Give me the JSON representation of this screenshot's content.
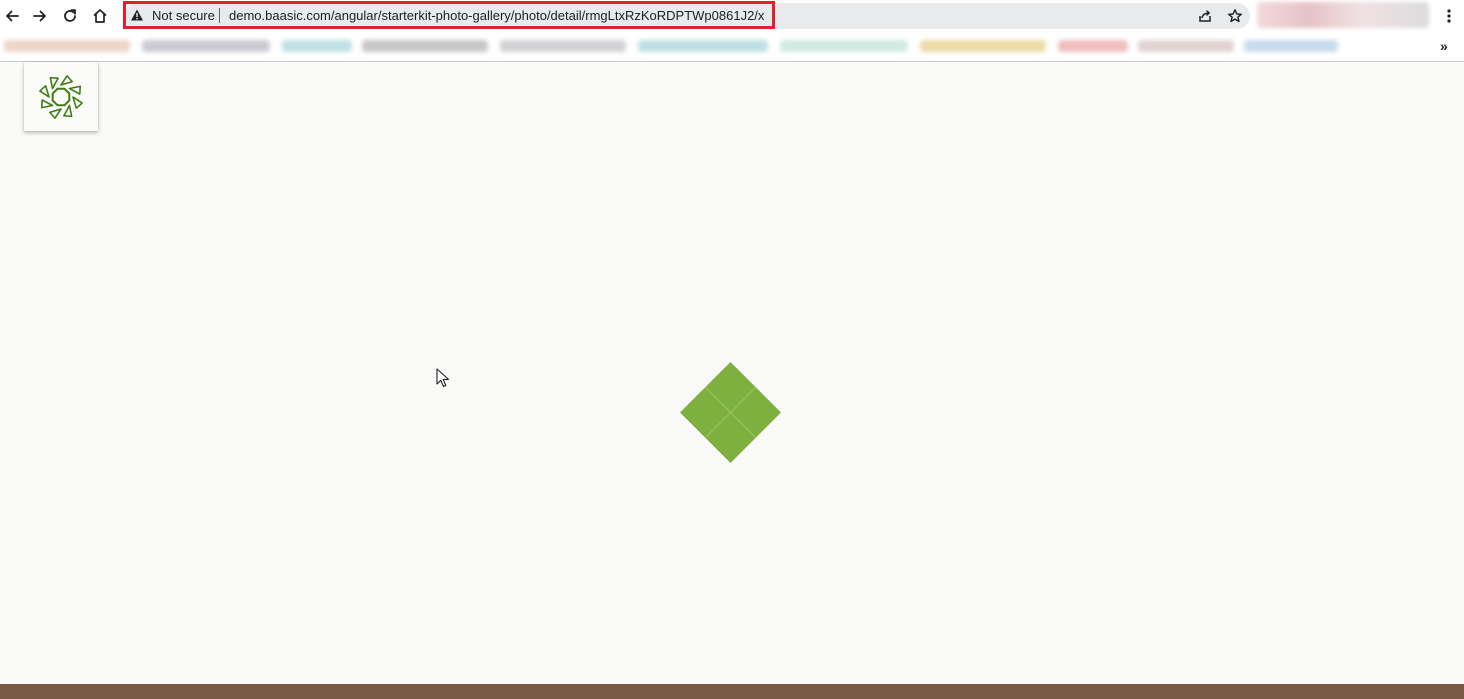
{
  "browser": {
    "security_label": "Not secure",
    "url": "demo.baasic.com/angular/starterkit-photo-gallery/photo/detail/rmgLtxRzKoRDPTWp0861J2/x",
    "icons": {
      "back": "arrow-left-icon",
      "forward": "arrow-right-icon",
      "reload": "reload-icon",
      "home": "home-icon",
      "warning": "warning-triangle-icon",
      "share": "share-icon",
      "bookmark": "star-icon",
      "menu": "kebab-menu-icon"
    },
    "bookmarks_overflow": "»"
  },
  "colors": {
    "highlight_border": "#e0212b",
    "logo_green": "#3f7d14",
    "loader_green": "#7db03e",
    "footer": "#7a5a44",
    "page_bg": "#fafaf8"
  }
}
